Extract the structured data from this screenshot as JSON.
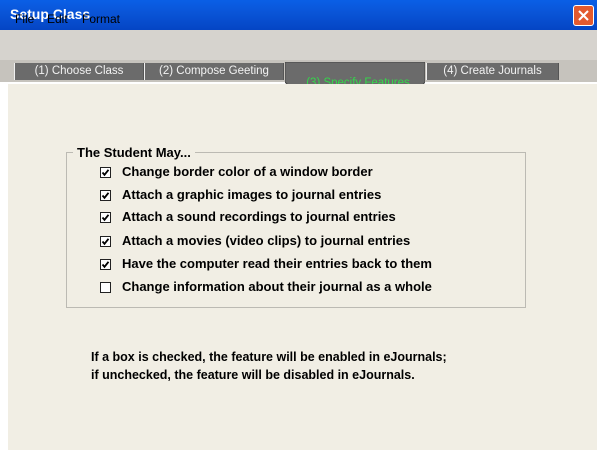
{
  "window": {
    "title": "Setup Class"
  },
  "menu": [
    "File",
    "Edit",
    "Format"
  ],
  "tabs": [
    "(1) Choose Class",
    "(2) Compose Geeting",
    "(3) Specify Features",
    "(4) Create Journals"
  ],
  "group": {
    "title": "The Student May...",
    "options": [
      {
        "label": "Change border color of a window border",
        "checked": true
      },
      {
        "label": "Attach a graphic images to journal entries",
        "checked": true
      },
      {
        "label": "Attach a sound recordings to journal entries",
        "checked": true
      },
      {
        "label": "Attach a movies (video clips) to journal entries",
        "checked": true
      },
      {
        "label": "Have the computer read their entries back to them",
        "checked": true
      },
      {
        "label": "Change information about their journal as a whole",
        "checked": false
      }
    ]
  },
  "note": [
    "If a box is checked, the feature will be enabled in eJournals;",
    "if unchecked, the feature will be disabled in eJournals."
  ],
  "colors": {
    "titlebar": "#0a55d8",
    "content_bg": "#f1eee4",
    "active_tab_text": "#33d84a",
    "close_button": "#e35a2f"
  }
}
